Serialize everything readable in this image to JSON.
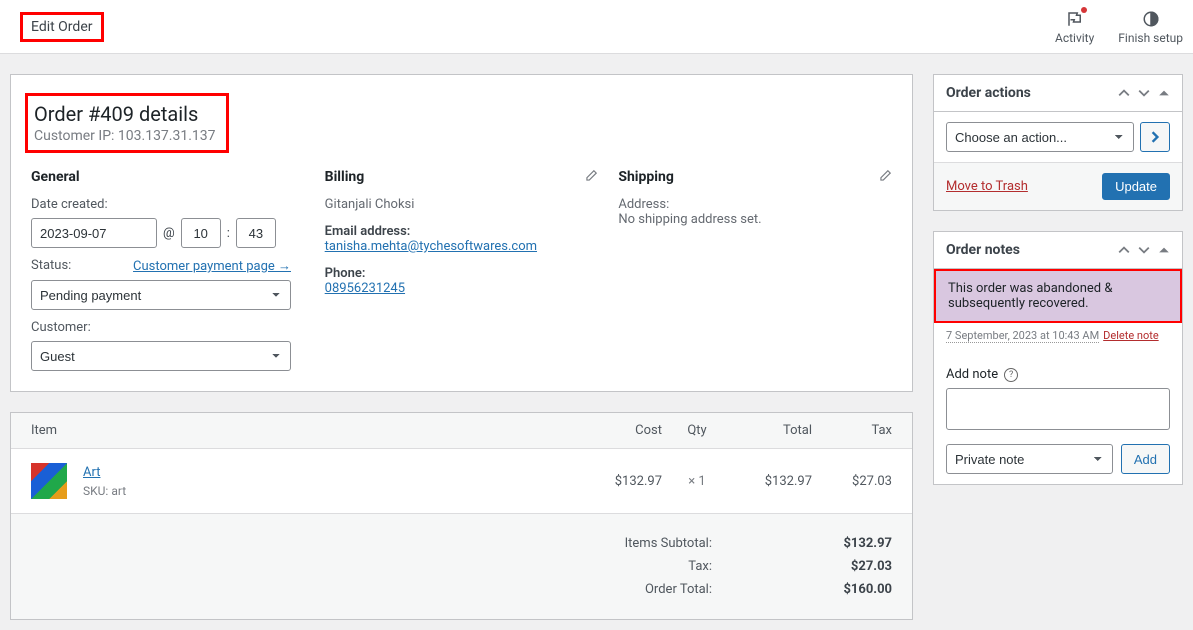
{
  "header": {
    "page_title": "Edit Order",
    "activity_label": "Activity",
    "finish_label": "Finish setup"
  },
  "order": {
    "title": "Order #409 details",
    "customer_ip": "Customer IP: 103.137.31.137"
  },
  "general": {
    "heading": "General",
    "date_label": "Date created:",
    "date": "2023-09-07",
    "at": "@",
    "hour": "10",
    "colon": ":",
    "min": "43",
    "status_label": "Status:",
    "cust_pay_link": "Customer payment page →",
    "status_value": "Pending payment",
    "customer_label": "Customer:",
    "customer_value": "Guest"
  },
  "billing": {
    "heading": "Billing",
    "name": "Gitanjali Choksi",
    "email_label": "Email address:",
    "email": "tanisha.mehta@tychesoftwares.com",
    "phone_label": "Phone:",
    "phone": "08956231245"
  },
  "shipping": {
    "heading": "Shipping",
    "addr_label": "Address:",
    "none": "No shipping address set."
  },
  "items": {
    "head": {
      "item": "Item",
      "cost": "Cost",
      "qty": "Qty",
      "total": "Total",
      "tax": "Tax"
    },
    "row": {
      "name": "Art",
      "sku_label": "SKU:",
      "sku": "art",
      "cost": "$132.97",
      "qty": "× 1",
      "total": "$132.97",
      "tax": "$27.03"
    },
    "totals": {
      "subtotal_l": "Items Subtotal:",
      "subtotal_v": "$132.97",
      "tax_l": "Tax:",
      "tax_v": "$27.03",
      "total_l": "Order Total:",
      "total_v": "$160.00"
    }
  },
  "sidebar": {
    "actions": {
      "title": "Order actions",
      "choose": "Choose an action...",
      "trash": "Move to Trash",
      "update": "Update"
    },
    "notes": {
      "title": "Order notes",
      "note_text": "This order was abandoned & subsequently recovered.",
      "timestamp": "7 September, 2023 at 10:43 AM",
      "delete": "Delete note",
      "add_label": "Add note",
      "note_type": "Private note",
      "add_btn": "Add"
    }
  }
}
